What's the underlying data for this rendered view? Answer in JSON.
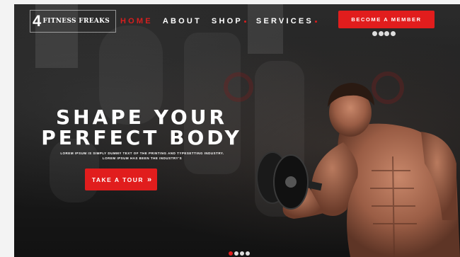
{
  "logo": {
    "mark": "4",
    "text": "FITNESS FREAKS"
  },
  "nav": [
    {
      "label": "HOME",
      "active": true
    },
    {
      "label": "ABOUT",
      "active": false
    },
    {
      "label": "SHOP",
      "active": false,
      "dropdown": true
    },
    {
      "label": "SERVICES",
      "active": false,
      "dropdown": true
    }
  ],
  "header": {
    "member_button": "BECOME A MEMBER"
  },
  "social_icons": [
    "facebook-icon",
    "twitter-icon",
    "google-plus-icon",
    "instagram-icon"
  ],
  "hero": {
    "headline_line1": "SHAPE YOUR",
    "headline_line2": "PERFECT BODY",
    "subtext_line1": "LOREM IPSUM IS SIMPLY DUMMY TEXT OF THE PRINTING AND TYPESETTING INDUSTRY.",
    "subtext_line2": "LOREM IPSUM HAS BEEN THE INDUSTRY'S",
    "cta": "TAKE A TOUR",
    "cta_arrow": "»"
  },
  "slider": {
    "total": 4,
    "active": 1
  },
  "colors": {
    "accent": "#e11d1d",
    "text": "#ffffff",
    "background": "#1c1c1c"
  }
}
